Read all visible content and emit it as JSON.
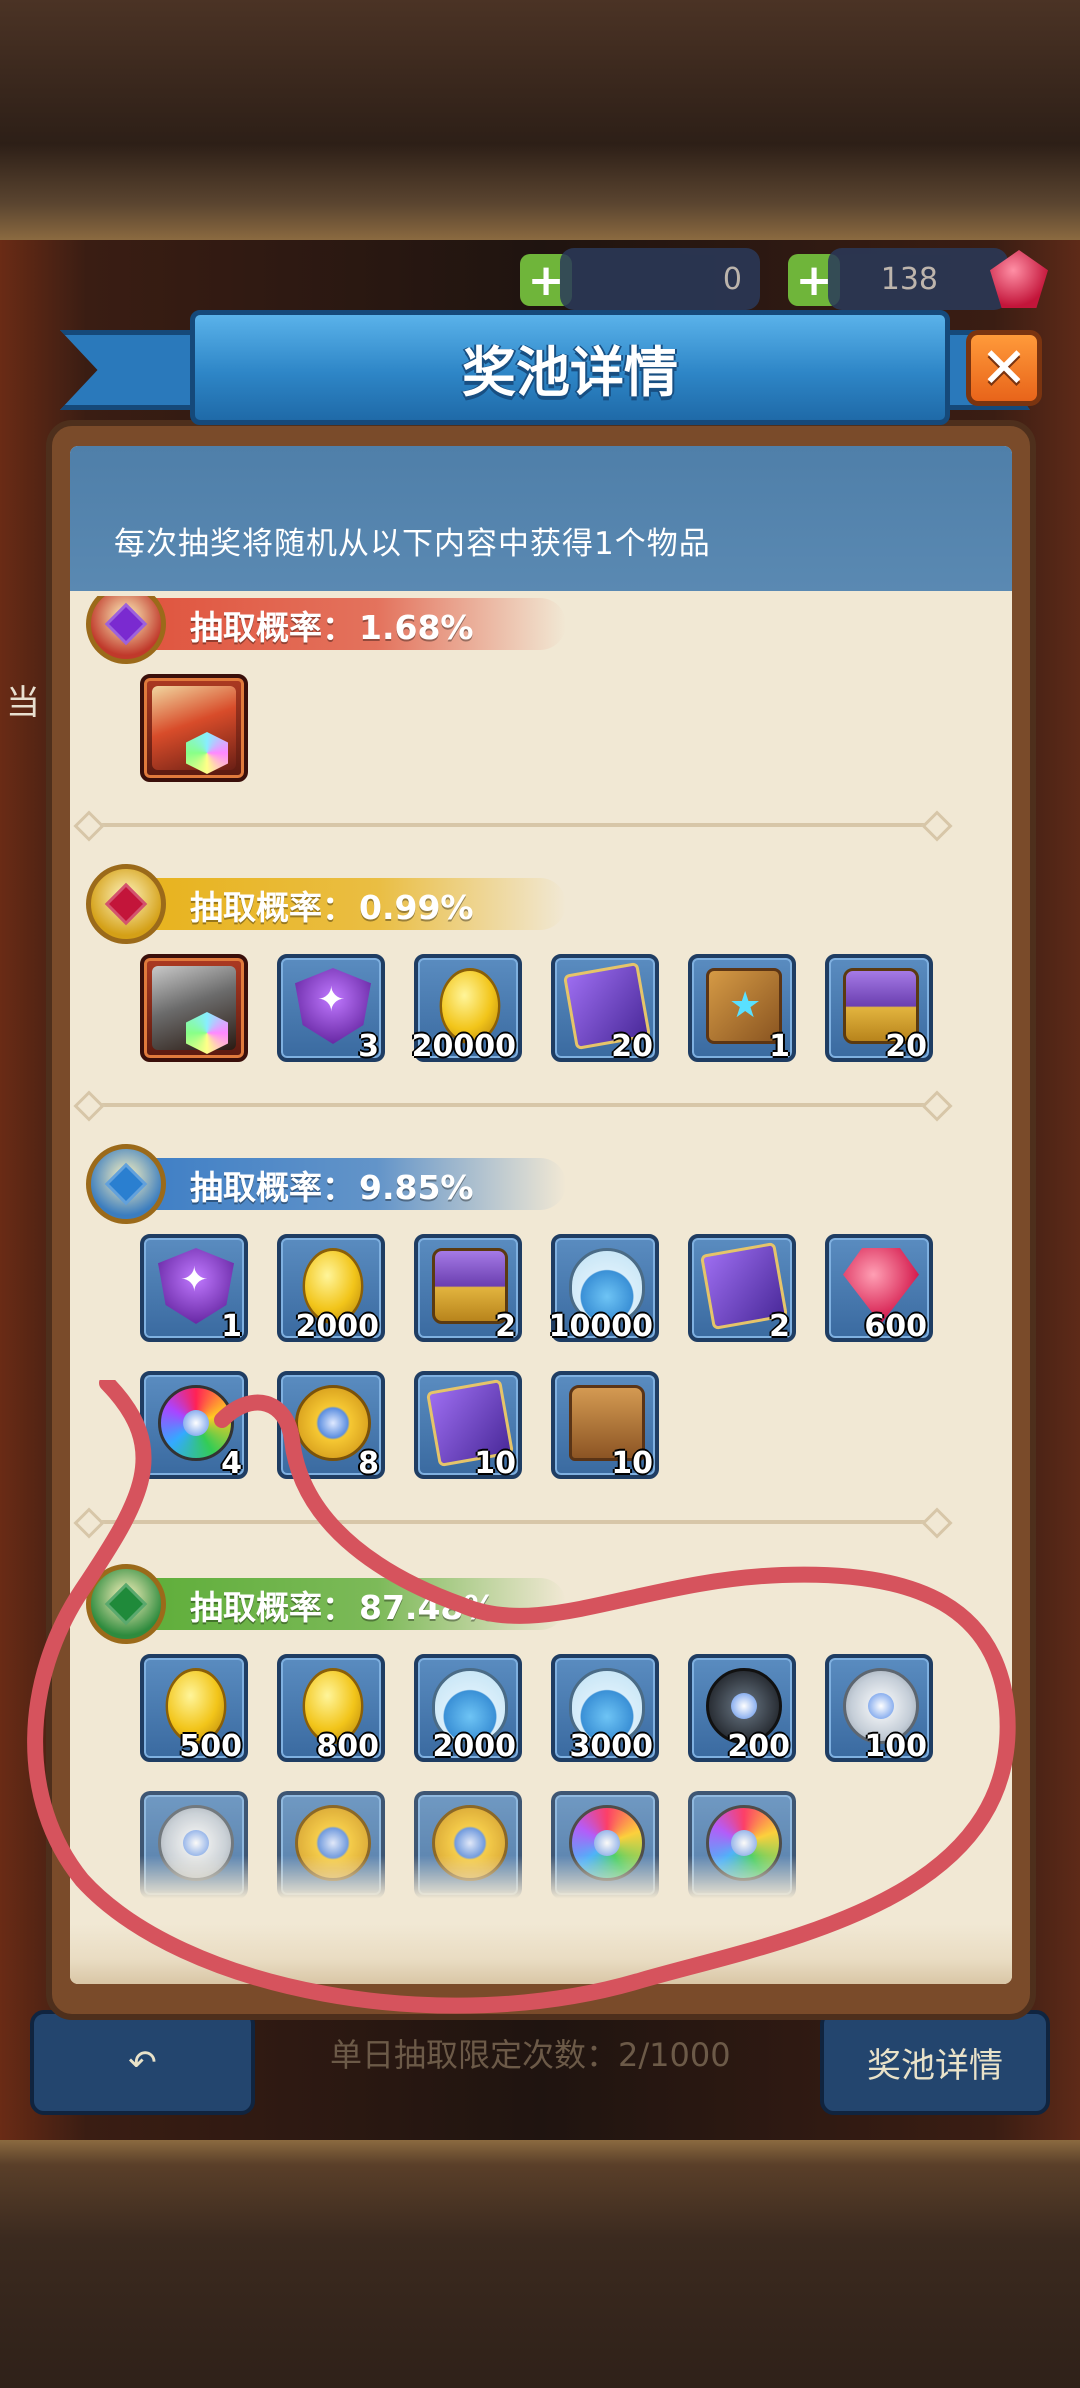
{
  "window": {
    "title": "奖池详情"
  },
  "description": "每次抽奖将随机从以下内容中获得1个物品",
  "close_label": "✕",
  "background": {
    "currency_1": "0",
    "currency_2": "138",
    "side_text": "当",
    "daily_limit": "单日抽取限定次数：2/1000",
    "pool_button": "奖池详情"
  },
  "tiers": [
    {
      "prefix": "抽取概率：",
      "rate": "1.68%",
      "color": "#e0553f",
      "items": [
        {
          "icon": "hero-icon",
          "qty": ""
        }
      ]
    },
    {
      "prefix": "抽取概率：",
      "rate": "0.99%",
      "color": "#e8b31e",
      "items": [
        {
          "icon": "hero-icon",
          "qty": ""
        },
        {
          "icon": "purple-shield-icon",
          "qty": "3"
        },
        {
          "icon": "gold-coin-icon",
          "qty": "20000"
        },
        {
          "icon": "purple-card-icon",
          "qty": "20"
        },
        {
          "icon": "gold-card-icon",
          "qty": "1"
        },
        {
          "icon": "treasure-chest-icon",
          "qty": "20"
        }
      ]
    },
    {
      "prefix": "抽取概率：",
      "rate": "9.85%",
      "color": "#3f7fc6",
      "items": [
        {
          "icon": "purple-shield-icon",
          "qty": "1"
        },
        {
          "icon": "gold-coin-icon",
          "qty": "2000"
        },
        {
          "icon": "treasure-chest-icon",
          "qty": "2"
        },
        {
          "icon": "potion-icon",
          "qty": "10000"
        },
        {
          "icon": "purple-card-icon",
          "qty": "2"
        },
        {
          "icon": "red-gem-icon",
          "qty": "600"
        },
        {
          "icon": "rainbow-orb-icon",
          "qty": "4"
        },
        {
          "icon": "gold-orb-icon",
          "qty": "8"
        },
        {
          "icon": "purple-card-icon",
          "qty": "10"
        },
        {
          "icon": "satchel-icon",
          "qty": "10"
        }
      ]
    },
    {
      "prefix": "抽取概率：",
      "rate": "87.48%",
      "color": "#5fae3a",
      "items": [
        {
          "icon": "gold-coin-icon",
          "qty": "500"
        },
        {
          "icon": "gold-coin-icon",
          "qty": "800"
        },
        {
          "icon": "potion-icon",
          "qty": "2000"
        },
        {
          "icon": "potion-icon",
          "qty": "3000"
        },
        {
          "icon": "dark-orb-icon",
          "qty": "200"
        },
        {
          "icon": "silver-orb-icon",
          "qty": "100"
        },
        {
          "icon": "silver-orb-icon",
          "qty": ""
        },
        {
          "icon": "gold-orb-icon",
          "qty": ""
        },
        {
          "icon": "gold-orb-icon",
          "qty": ""
        },
        {
          "icon": "rainbow-orb-icon",
          "qty": ""
        },
        {
          "icon": "rainbow-orb-icon",
          "qty": ""
        }
      ]
    }
  ],
  "annotation_color": "#d6535d"
}
